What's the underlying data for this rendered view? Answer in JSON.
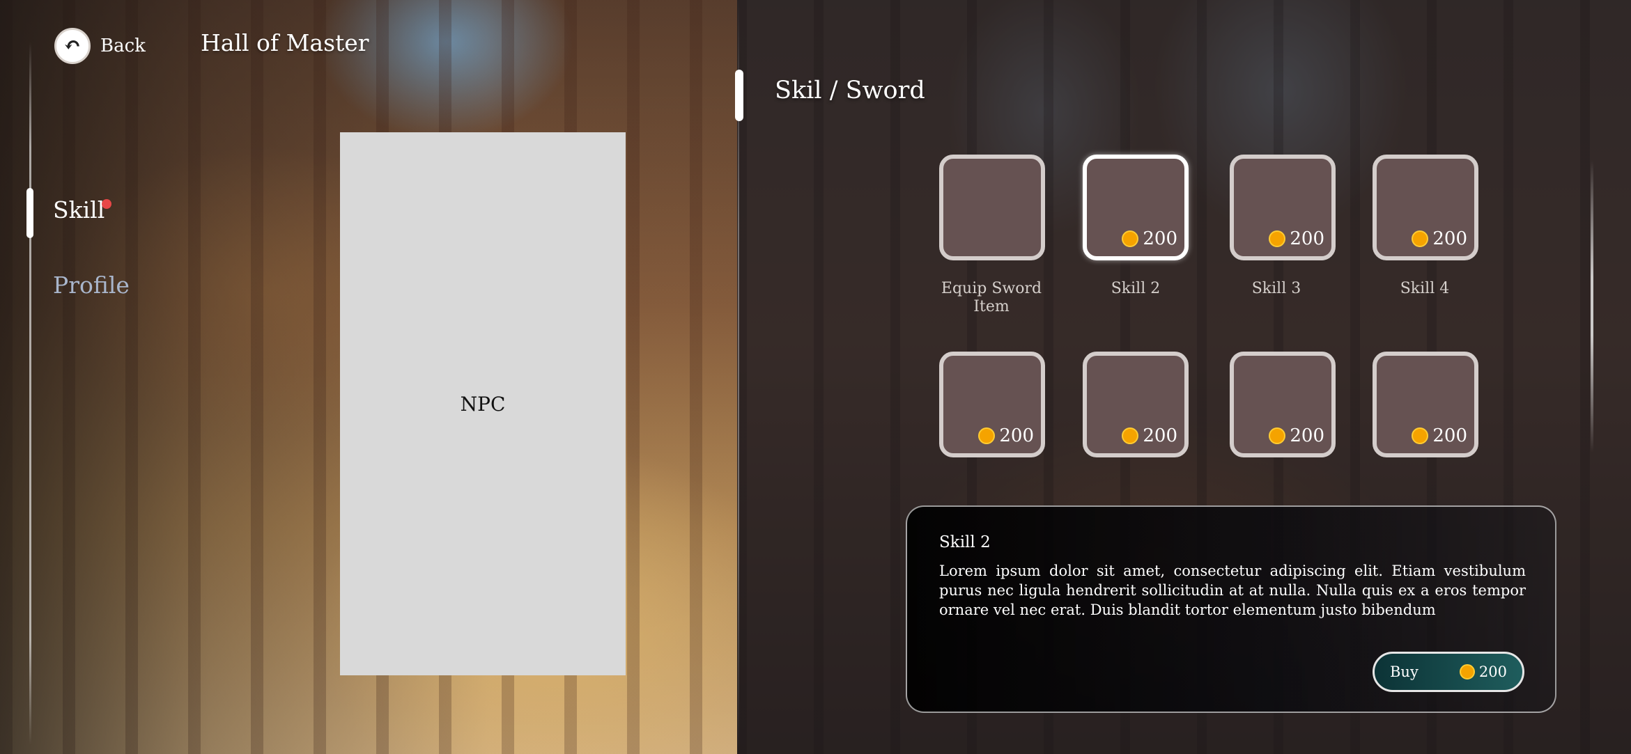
{
  "header": {
    "back_label": "Back",
    "title": "Hall of Master"
  },
  "nav": {
    "items": [
      {
        "label": "Skill",
        "active": true,
        "badge": true
      },
      {
        "label": "Profile",
        "active": false,
        "badge": false
      }
    ]
  },
  "npc": {
    "label": "NPC"
  },
  "panel": {
    "breadcrumb": "Skil / Sword"
  },
  "skills": [
    {
      "label": "Equip Sword Item",
      "price": null,
      "selected": false
    },
    {
      "label": "Skill 2",
      "price": "200",
      "selected": true
    },
    {
      "label": "Skill 3",
      "price": "200",
      "selected": false
    },
    {
      "label": "Skill 4",
      "price": "200",
      "selected": false
    },
    {
      "label": "",
      "price": "200",
      "selected": false
    },
    {
      "label": "",
      "price": "200",
      "selected": false
    },
    {
      "label": "",
      "price": "200",
      "selected": false
    },
    {
      "label": "",
      "price": "200",
      "selected": false
    }
  ],
  "detail": {
    "title": "Skill 2",
    "description": "Lorem ipsum dolor sit amet, consectetur adipiscing elit. Etiam vestibulum purus nec ligula hendrerit sollicitudin at at nulla. Nulla quis ex a eros tempor ornare vel nec erat. Duis blandit tortor elementum justo bibendum",
    "buy_label": "Buy",
    "buy_price": "200"
  },
  "colors": {
    "coin": "#f5a300",
    "notification": "#e84747",
    "slot_fill": "#665252",
    "buy_button": "#1f5d5d",
    "profile_text": "#a9b6cc"
  },
  "icons": {
    "back": "back-arrow-icon",
    "currency": "coin-icon"
  }
}
